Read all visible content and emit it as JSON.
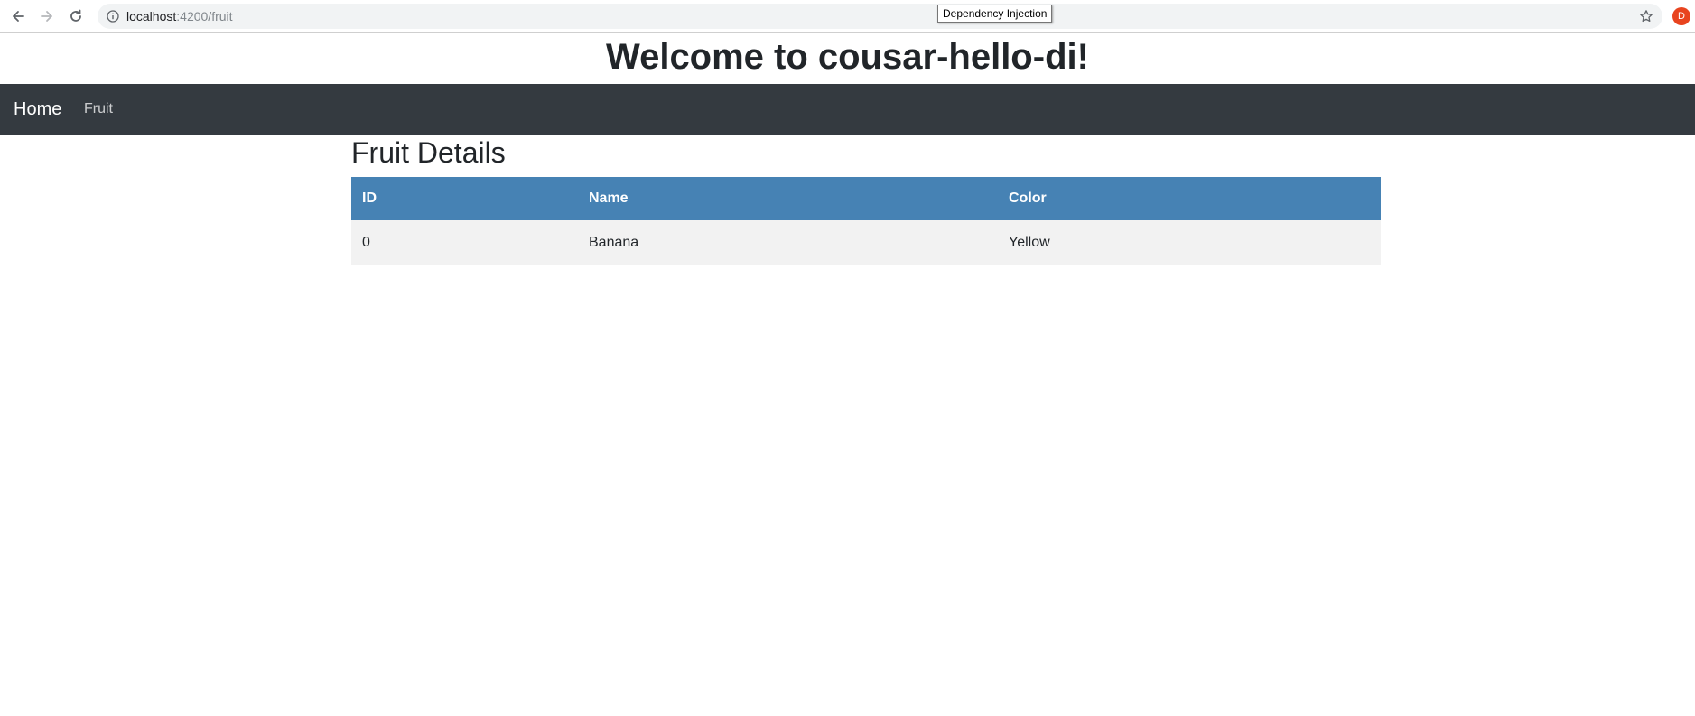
{
  "browser": {
    "url_host": "localhost",
    "url_path": ":4200/fruit",
    "tooltip": "Dependency Injection",
    "profile_initial": "D",
    "icons": {
      "back": "arrow-left-icon",
      "forward": "arrow-right-icon",
      "reload": "reload-icon",
      "site_info": "info-circle-icon",
      "bookmark": "star-icon"
    }
  },
  "page": {
    "title": "Welcome to cousar-hello-di!"
  },
  "navbar": {
    "brand": "Home",
    "links": [
      "Fruit"
    ],
    "background": "#343a40"
  },
  "main": {
    "heading": "Fruit Details",
    "table": {
      "header_color": "#4682b4",
      "columns": [
        "ID",
        "Name",
        "Color"
      ],
      "rows": [
        [
          "0",
          "Banana",
          "Yellow"
        ]
      ]
    }
  }
}
